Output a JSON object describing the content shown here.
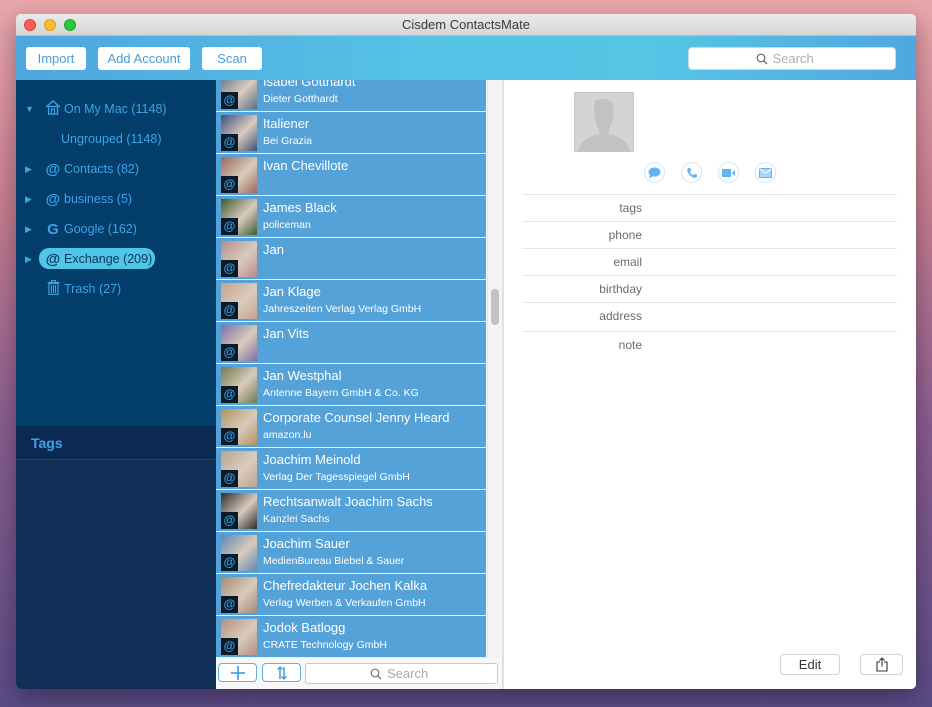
{
  "window": {
    "title": "Cisdem ContactsMate"
  },
  "toolbar": {
    "import_label": "Import",
    "add_account_label": "Add Account",
    "scan_label": "Scan",
    "search_placeholder": "Search"
  },
  "sidebar": {
    "accounts": [
      {
        "label": "On My Mac (1148)",
        "icon": "house-icon",
        "expanded": true
      },
      {
        "label": "Ungrouped (1148)",
        "icon": "",
        "child": true
      },
      {
        "label": "Contacts (82)",
        "icon": "at-icon"
      },
      {
        "label": "business (5)",
        "icon": "at-icon"
      },
      {
        "label": "Google (162)",
        "icon": "google-icon"
      },
      {
        "label": "Exchange (209)",
        "icon": "at-icon",
        "selected": true
      },
      {
        "label": "Trash (27)",
        "icon": "trash-icon"
      }
    ],
    "tags_header": "Tags"
  },
  "contacts": [
    {
      "name": "Isabel Gotthardt",
      "subtitle": "Dieter Gotthardt",
      "avatar_color": "#5a6f8a"
    },
    {
      "name": "Italiener",
      "subtitle": "Bei Grazia",
      "avatar_color": "#3d4f7a"
    },
    {
      "name": "Ivan Chevillote",
      "subtitle": "",
      "avatar_color": "#9b6a5a"
    },
    {
      "name": "James Black",
      "subtitle": "policeman",
      "avatar_color": "#3f5a2e"
    },
    {
      "name": "Jan",
      "subtitle": "",
      "avatar_color": "#b68c8c"
    },
    {
      "name": "Jan Klage",
      "subtitle": "Jahreszeiten Verlag Verlag GmbH",
      "avatar_color": "#c7a48a"
    },
    {
      "name": "Jan Vits",
      "subtitle": "",
      "avatar_color": "#7b6fa8"
    },
    {
      "name": "Jan Westphal",
      "subtitle": "Antenne Bayern GmbH & Co. KG",
      "avatar_color": "#6d7a4f"
    },
    {
      "name": "Corporate Counsel Jenny Heard",
      "subtitle": "amazon.lu",
      "avatar_color": "#b0925e"
    },
    {
      "name": "Joachim Meinold",
      "subtitle": "Verlag Der Tagesspiegel GmbH",
      "avatar_color": "#b9a48f"
    },
    {
      "name": "Rechtsanwalt Joachim Sachs",
      "subtitle": "Kanzlei Sachs",
      "avatar_color": "#2b2b2b"
    },
    {
      "name": "Joachim Sauer",
      "subtitle": "MedienBureau Biebel & Sauer",
      "avatar_color": "#5f86b3"
    },
    {
      "name": "Chefredakteur Jochen Kalka",
      "subtitle": "Verlag Werben & Verkaufen GmbH",
      "avatar_color": "#a28b70"
    },
    {
      "name": "Jodok Batlogg",
      "subtitle": "CRATE Technology GmbH",
      "avatar_color": "#b58f80"
    }
  ],
  "list_footer": {
    "add_label": "+",
    "sort_label": "⇅",
    "search_placeholder": "Search"
  },
  "detail": {
    "actions": [
      "message-icon",
      "phone-icon",
      "video-icon",
      "mail-icon"
    ],
    "fields": [
      {
        "label": "tags",
        "value": ""
      },
      {
        "label": "phone",
        "value": ""
      },
      {
        "label": "email",
        "value": ""
      },
      {
        "label": "birthday",
        "value": ""
      },
      {
        "label": "address",
        "value": ""
      },
      {
        "label": "note",
        "value": ""
      }
    ],
    "edit_label": "Edit"
  },
  "colors": {
    "accent": "#55a2d8",
    "sidebar_bg": "#033d69",
    "selected_pill": "#4fc6e7"
  }
}
